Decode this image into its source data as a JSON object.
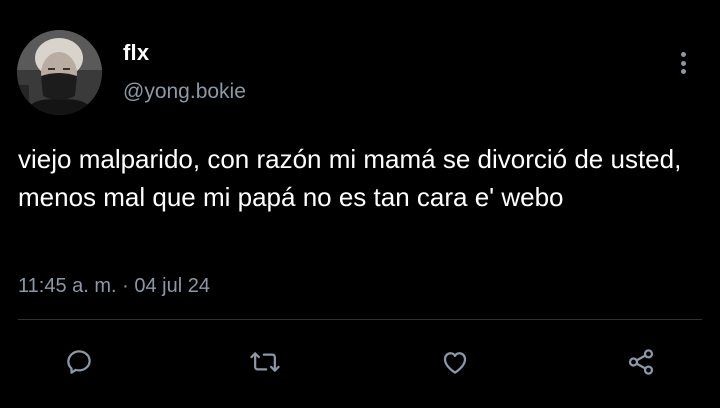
{
  "user": {
    "display_name": "flx",
    "handle": "@yong.bokie",
    "avatar": "profile-photo"
  },
  "tweet": {
    "text": "viejo malparido, con razón mi mamá se divorció de usted, menos mal que mi papá no es tan cara e' webo",
    "timestamp": "11:45 a. m. · 04 jul 24"
  },
  "actions": {
    "reply_icon": "reply-icon",
    "retweet_icon": "retweet-icon",
    "like_icon": "heart-icon",
    "share_icon": "share-icon",
    "more_icon": "more-vertical-icon"
  },
  "colors": {
    "background": "#000000",
    "primary_text": "#ffffff",
    "secondary_text": "#8b98a5",
    "divider": "#2f3336"
  }
}
